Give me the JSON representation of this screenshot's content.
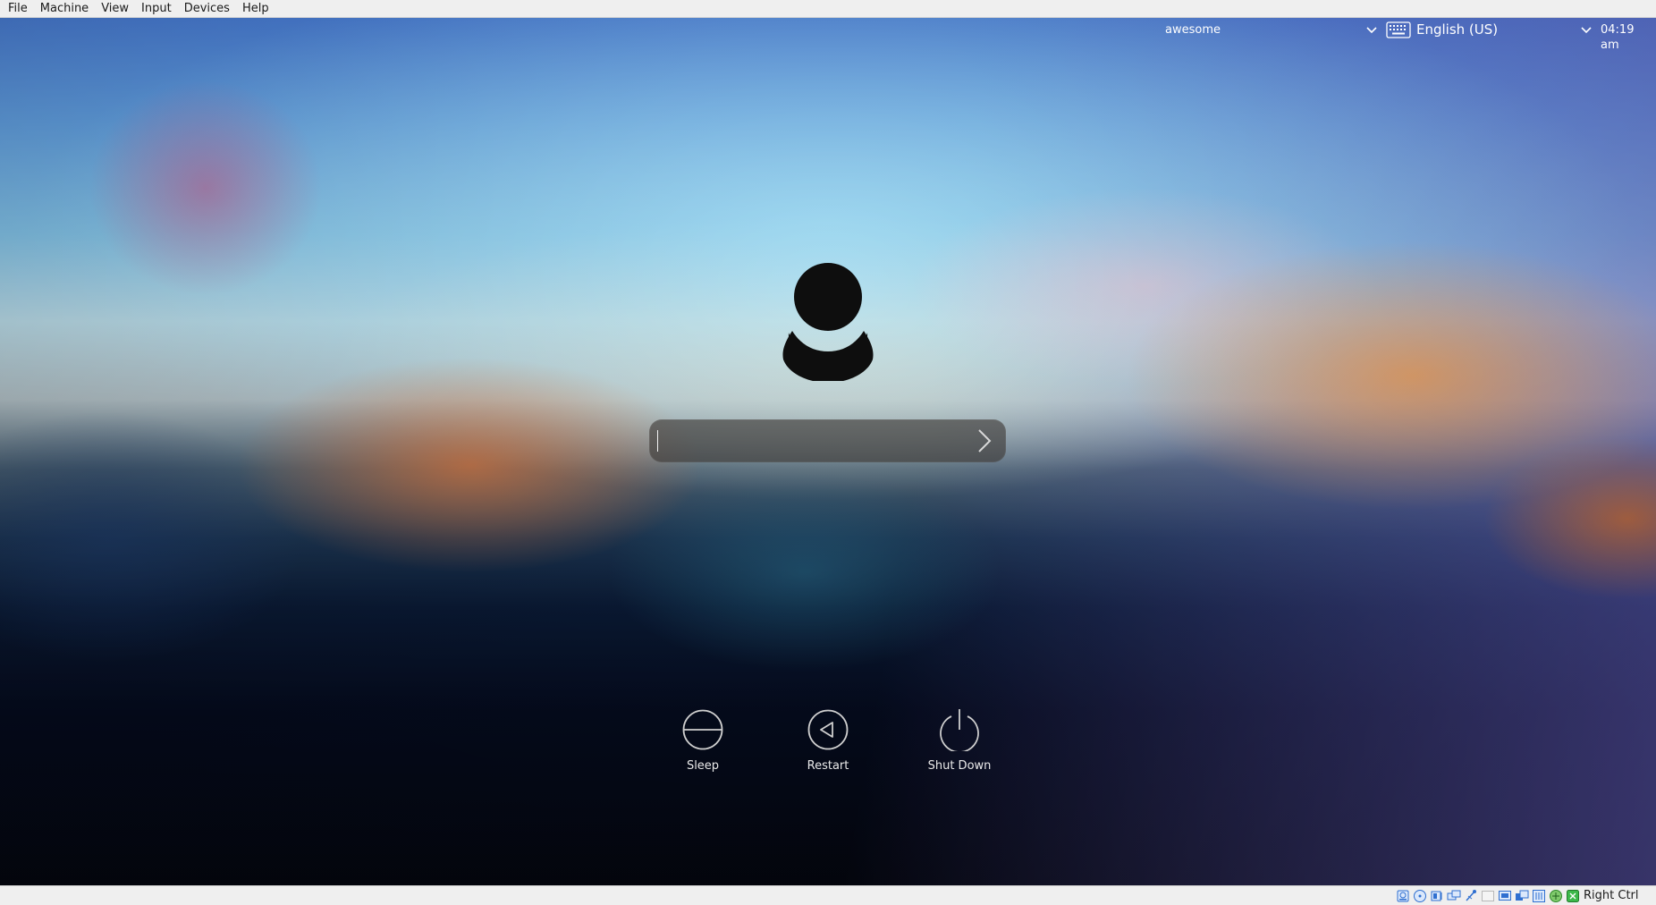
{
  "menubar": {
    "items": [
      "File",
      "Machine",
      "View",
      "Input",
      "Devices",
      "Help"
    ]
  },
  "topbar": {
    "session": "awesome",
    "keyboard_layout": "English (US)",
    "clock": "04:19 am"
  },
  "login": {
    "password_placeholder": "",
    "password_value": ""
  },
  "power_actions": {
    "sleep": "Sleep",
    "restart": "Restart",
    "shutdown": "Shut Down"
  },
  "statusbar": {
    "host_key": "Right Ctrl",
    "icons": [
      "hard-disk-icon",
      "optical-drive-icon",
      "audio-icon",
      "network-icon",
      "usb-icon",
      "shared-folders-icon",
      "display-icon",
      "video-capture-icon",
      "mouse-integration-icon",
      "keyboard-capture-icon",
      "host-key-icon"
    ]
  },
  "colors": {
    "menubar_bg": "#efefef",
    "statusbar_icon": "#2f6fd0",
    "avatar": "#0e0e0e",
    "power_icon_stroke": "#cfcfcf"
  }
}
